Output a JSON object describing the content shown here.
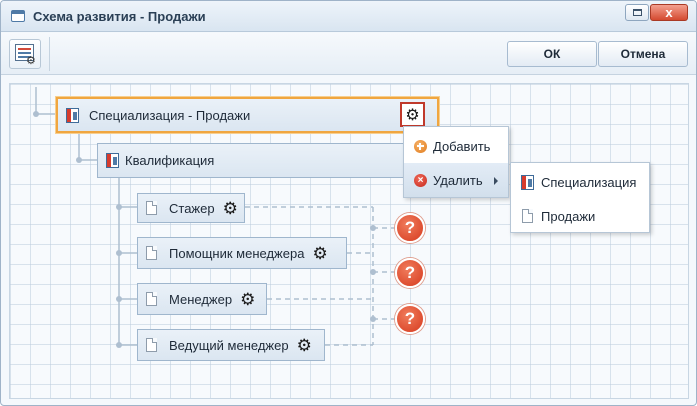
{
  "window": {
    "title": "Схема развития - Продажи",
    "close_glyph": "x"
  },
  "toolbar": {
    "ok_label": "ОК",
    "cancel_label": "Отмена"
  },
  "tree": {
    "root": {
      "label": "Специализация - Продажи",
      "icon": "book-icon"
    },
    "qualification": {
      "label": "Квалификация",
      "icon": "book-icon"
    },
    "positions": [
      {
        "label": "Стажер",
        "icon": "page-icon"
      },
      {
        "label": "Помощник менеджера",
        "icon": "page-icon"
      },
      {
        "label": "Менеджер",
        "icon": "page-icon"
      },
      {
        "label": "Ведущий менеджер",
        "icon": "page-icon"
      }
    ],
    "help_glyph": "?"
  },
  "context_menu": {
    "items": [
      {
        "label": "Добавить",
        "icon": "add-circle-icon"
      },
      {
        "label": "Удалить",
        "icon": "delete-circle-icon"
      }
    ]
  },
  "submenu": {
    "items": [
      {
        "label": "Специализация",
        "icon": "book-icon"
      },
      {
        "label": "Продажи",
        "icon": "page-icon"
      }
    ]
  },
  "icons": {
    "gear_glyph": "⚙"
  },
  "colors": {
    "selection": "#f0a640",
    "gear_frame": "#c0392b",
    "help_badge": "#d63a1e"
  }
}
